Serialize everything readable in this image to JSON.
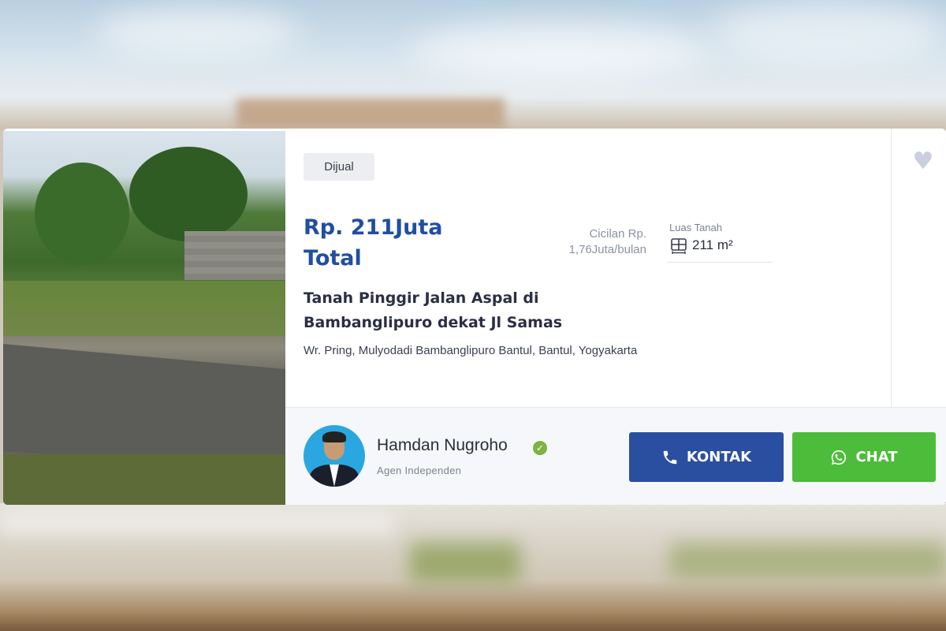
{
  "listing": {
    "badge": "Dijual",
    "price_line1": "Rp. 211Juta",
    "price_line2": "Total",
    "cicilan_line1": "Cicilan Rp.",
    "cicilan_line2": "1,76Juta/bulan",
    "luas_label": "Luas Tanah",
    "luas_value": "211 m²",
    "title": "Tanah Pinggir Jalan Aspal di Bambanglipuro dekat Jl Samas",
    "address": "Wr. Pring, Mulyodadi Bambanglipuro Bantul, Bantul, Yogyakarta"
  },
  "agent": {
    "name": "Hamdan Nugroho",
    "role": "Agen Independen"
  },
  "actions": {
    "kontak_label": "KONTAK",
    "chat_label": "CHAT"
  },
  "colors": {
    "price": "#1f4fa0",
    "kontak_button": "#2a4fa0",
    "chat_button": "#4cbc3a",
    "verified": "#7cb342",
    "favorite": "#c9cfdf"
  },
  "icons": {
    "favorite": "heart-icon",
    "verified": "check-circle-icon",
    "kontak": "phone-icon",
    "chat": "whatsapp-icon",
    "luas": "land-area-icon"
  }
}
